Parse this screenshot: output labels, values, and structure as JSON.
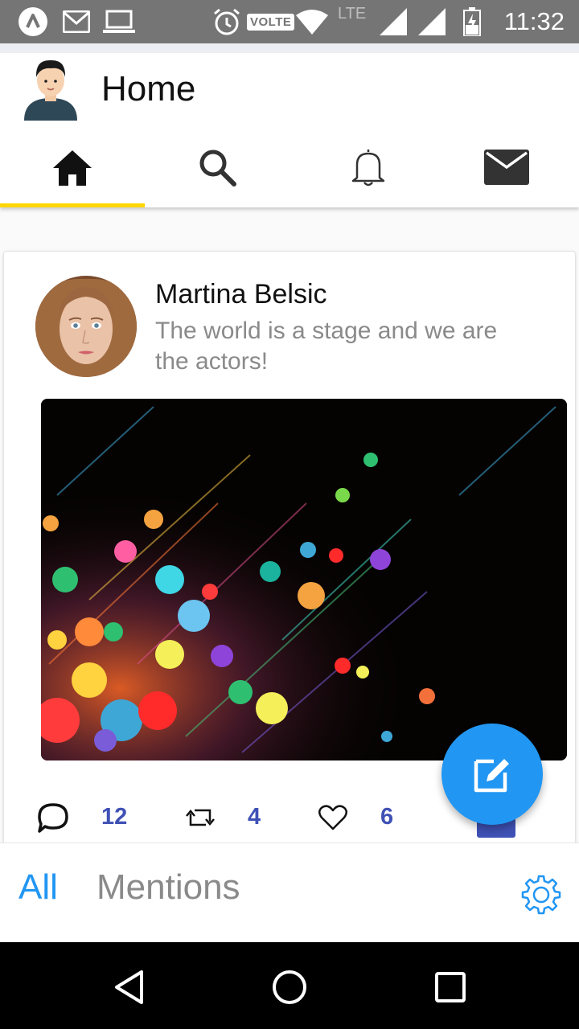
{
  "status_bar": {
    "time": "11:32",
    "volte": "VOLTE",
    "network": "LTE",
    "icons": [
      "app-notification-icon",
      "gmail-icon",
      "laptop-icon",
      "alarm-icon",
      "volte-icon",
      "wifi-icon",
      "signal-icon",
      "signal-icon",
      "battery-charging-icon"
    ]
  },
  "header": {
    "title": "Home"
  },
  "tabs": [
    {
      "name": "home",
      "icon": "home-icon",
      "active": true
    },
    {
      "name": "search",
      "icon": "search-icon",
      "active": false
    },
    {
      "name": "notifications",
      "icon": "bell-icon",
      "active": false
    },
    {
      "name": "messages",
      "icon": "mail-icon",
      "active": false
    }
  ],
  "post": {
    "author": "Martina Belsic",
    "text": "The world is a stage and we are the actors!",
    "comments": "12",
    "retweets": "4",
    "likes": "6"
  },
  "bottom_tabs": {
    "all": "All",
    "mentions": "Mentions"
  },
  "colors": {
    "accent": "#2196f3",
    "indicator": "#ffd700",
    "count": "#3f51b5",
    "status_bar": "#757575"
  }
}
